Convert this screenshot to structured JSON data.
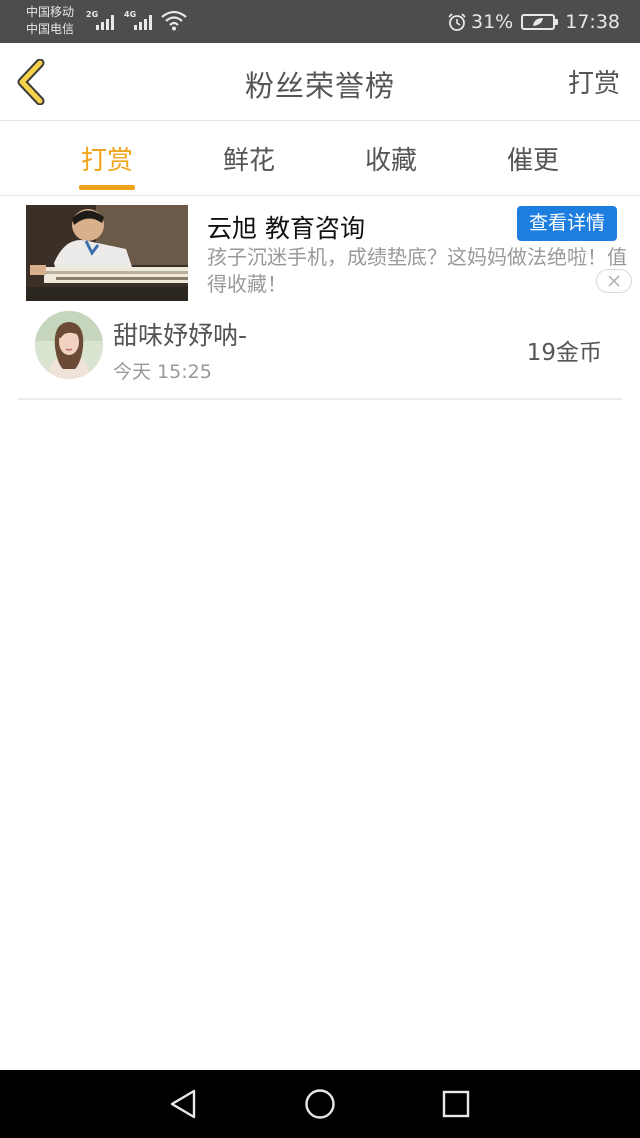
{
  "status_bar": {
    "carrier1": "中国移动",
    "carrier2": "中国电信",
    "network1": "2G",
    "network2": "4G",
    "battery": "31%",
    "time": "17:38"
  },
  "header": {
    "back_icon": "chevron-left-icon",
    "title": "粉丝荣誉榜",
    "action": "打赏"
  },
  "tabs": [
    {
      "label": "打赏",
      "active": true
    },
    {
      "label": "鲜花",
      "active": false
    },
    {
      "label": "收藏",
      "active": false
    },
    {
      "label": "催更",
      "active": false
    }
  ],
  "ad": {
    "title": "云旭  教育咨询",
    "button": "查看详情",
    "description": "孩子沉迷手机，成绩垫底？这妈妈做法绝啦！值得收藏！",
    "close_icon": "close-icon"
  },
  "list": [
    {
      "name": "甜味妤妤呐-",
      "time": "今天 15:25",
      "value": "19金币"
    }
  ],
  "colors": {
    "accent": "#f1a31b",
    "ad_button": "#1d7ee0",
    "status_bar": "#4d4d4d"
  },
  "nav": {
    "back_icon": "triangle-back-icon",
    "home_icon": "circle-home-icon",
    "recents_icon": "square-recents-icon"
  }
}
